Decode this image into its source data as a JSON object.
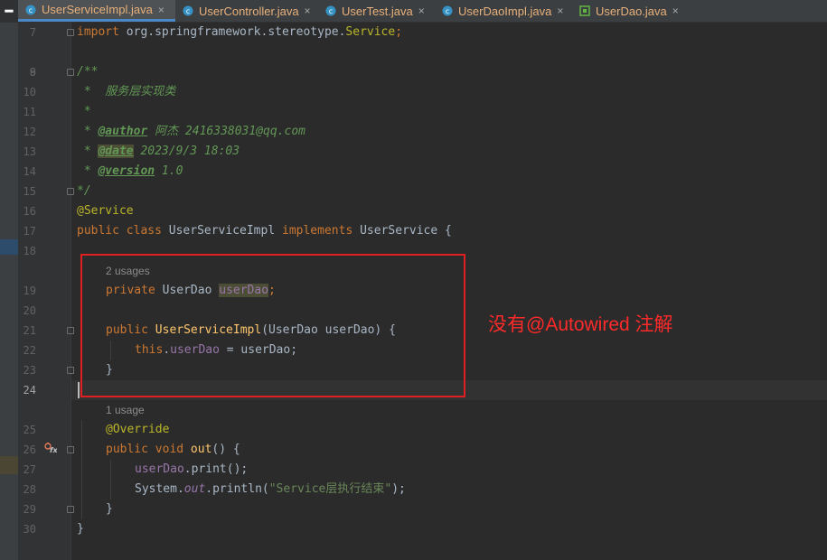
{
  "tabs": [
    {
      "name": "UserServiceImpl.java",
      "active": true,
      "icon": "class-icon"
    },
    {
      "name": "UserController.java",
      "active": false,
      "icon": "class-icon"
    },
    {
      "name": "UserTest.java",
      "active": false,
      "icon": "class-icon"
    },
    {
      "name": "UserDaoImpl.java",
      "active": false,
      "icon": "class-icon"
    },
    {
      "name": "UserDao.java",
      "active": false,
      "icon": "interface-icon"
    }
  ],
  "tab_close_glyph": "×",
  "menu_glyph": "━",
  "line_numbers": [
    "7",
    "8",
    "9",
    "10",
    "11",
    "12",
    "13",
    "14",
    "15",
    "16",
    "17",
    "18",
    "19",
    "20",
    "21",
    "22",
    "23",
    "24",
    "25",
    "26",
    "27",
    "28",
    "29",
    "30"
  ],
  "code": {
    "import_kw": "import",
    "import_pkg": " org.springframework.stereotype.",
    "import_cls": "Service",
    "semi": ";",
    "doc_open": "/**",
    "doc_desc": " *  服务层实现类",
    "doc_star": " *",
    "doc_prefix": " * ",
    "author_tag": "@author",
    "author_val": " 阿杰 2416338031@qq.com",
    "date_tag": "@date",
    "date_val": " 2023/9/3 18:03",
    "version_tag": "@version",
    "version_val": " 1.0",
    "doc_close": "*/",
    "service_ann": "@Service",
    "class_public": "public",
    "class_class": " class",
    "class_name": " UserServiceImpl ",
    "class_impl": "implements",
    "class_iface": " UserService {",
    "hint_field": "2 usages",
    "field_private": "private",
    "field_type": " UserDao ",
    "field_name": "userDao",
    "ctor_public": "public",
    "ctor_name": " UserServiceImpl",
    "ctor_params": "(UserDao userDao) {",
    "this_kw": "this",
    "this_dot": ".",
    "this_field": "userDao",
    "this_rest": " = userDao;",
    "close_brace": "}",
    "hint_method": "1 usage",
    "override_ann": "@Override",
    "method_public": "public",
    "method_void": " void",
    "method_name": " out",
    "method_rest": "() {",
    "call_field": "userDao",
    "call_rest": ".print();",
    "sys_pre": "System.",
    "sys_out": "out",
    "sys_mid": ".println(",
    "sys_str": "\"Service层执行结束\"",
    "sys_end": ");",
    "class_close": "}"
  },
  "gutter_override_icon": "override-implements-icon",
  "annotation_note": "没有@Autowired 注解",
  "colors": {
    "editor_bg": "#2b2b2b",
    "keyword": "#cc7832",
    "annotation": "#bbb529",
    "doc_comment": "#629755",
    "field": "#9876aa",
    "method": "#ffc66d",
    "string": "#6a8759",
    "red_box": "#e02020"
  }
}
